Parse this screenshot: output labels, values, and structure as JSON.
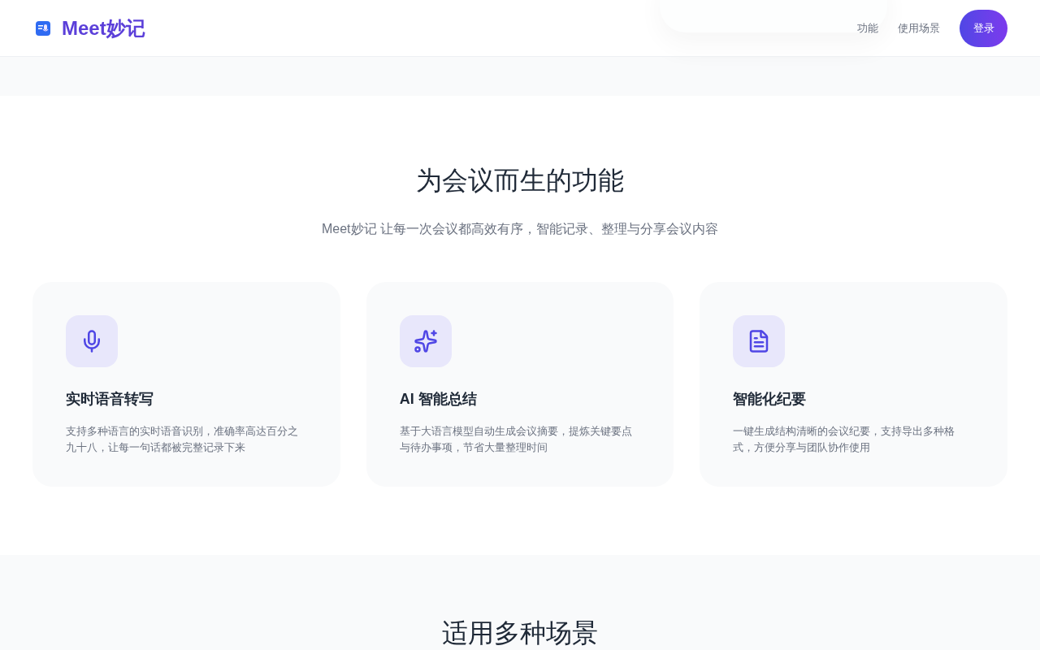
{
  "header": {
    "brand": "Meet妙记",
    "nav": [
      {
        "label": "功能"
      },
      {
        "label": "使用场景"
      }
    ],
    "login_button": "登录"
  },
  "features": {
    "title": "为会议而生的功能",
    "subtitle": "Meet妙记 让每一次会议都高效有序，智能记录、整理与分享会议内容",
    "cards": [
      {
        "kind": "mic",
        "title": "实时语音转写",
        "description": "支持多种语言的实时语音识别，准确率高达百分之九十八，让每一句话都被完整记录下来"
      },
      {
        "kind": "sparkle",
        "title": "AI 智能总结",
        "description": "基于大语言模型自动生成会议摘要，提炼关键要点与待办事项，节省大量整理时间"
      },
      {
        "kind": "document",
        "title": "智能化纪要",
        "description": "一键生成结构清晰的会议纪要，支持导出多种格式，方便分享与团队协作使用"
      }
    ]
  },
  "scenarios": {
    "title": "适用多种场景"
  }
}
